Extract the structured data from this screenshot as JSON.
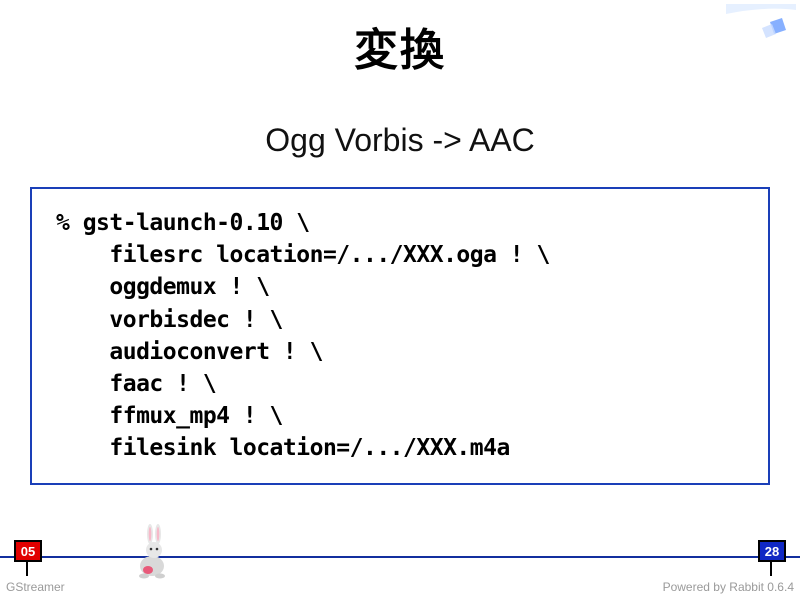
{
  "slide": {
    "title": "変換",
    "subtitle": "Ogg Vorbis -> AAC",
    "code": "% gst-launch-0.10 \\\n    filesrc location=/.../XXX.oga ! \\\n    oggdemux ! \\\n    vorbisdec ! \\\n    audioconvert ! \\\n    faac ! \\\n    ffmux_mp4 ! \\\n    filesink location=/.../XXX.m4a"
  },
  "progress": {
    "current": "05",
    "total": "28"
  },
  "footer": {
    "left": "GStreamer",
    "right": "Powered by Rabbit 0.6.4"
  }
}
